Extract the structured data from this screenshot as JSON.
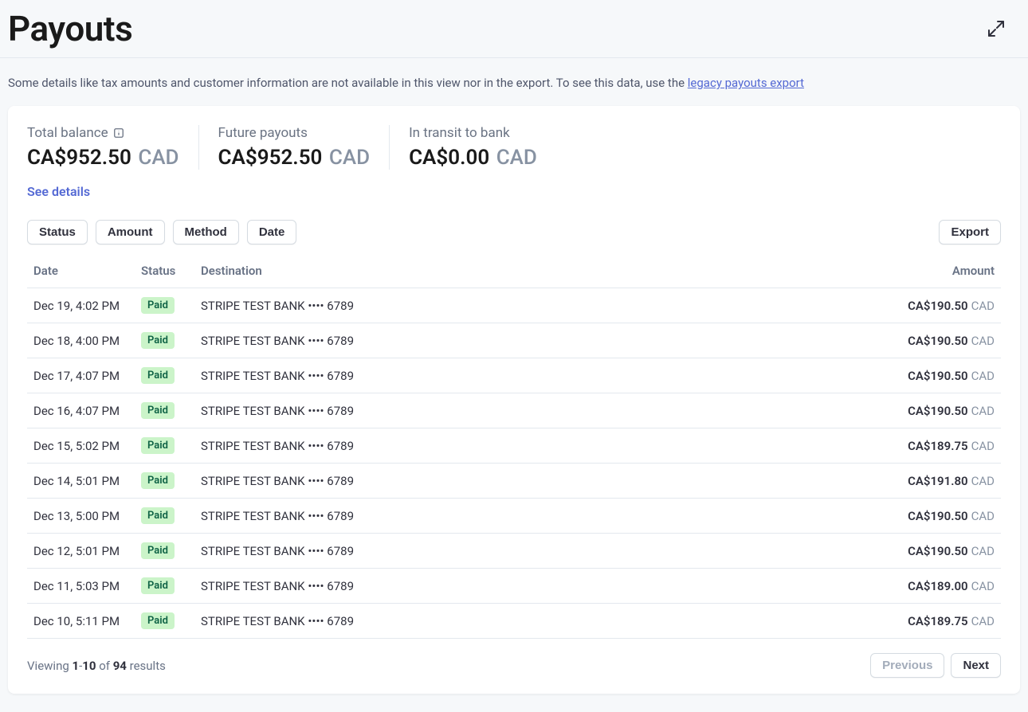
{
  "header": {
    "title": "Payouts"
  },
  "banner": {
    "text": "Some details like tax amounts and customer information are not available in this view nor in the export. To see this data, use the ",
    "link_text": "legacy payouts export"
  },
  "summary": {
    "total_balance": {
      "label": "Total balance",
      "value": "CA$952.50",
      "currency": "CAD"
    },
    "future_payouts": {
      "label": "Future payouts",
      "value": "CA$952.50",
      "currency": "CAD"
    },
    "in_transit": {
      "label": "In transit to bank",
      "value": "CA$0.00",
      "currency": "CAD"
    },
    "see_details": "See details"
  },
  "filters": {
    "status": "Status",
    "amount": "Amount",
    "method": "Method",
    "date": "Date",
    "export": "Export"
  },
  "table": {
    "headers": {
      "date": "Date",
      "status": "Status",
      "destination": "Destination",
      "amount": "Amount"
    },
    "rows": [
      {
        "date": "Dec 19, 4:02 PM",
        "status": "Paid",
        "destination": "STRIPE TEST BANK •••• 6789",
        "amount": "CA$190.50",
        "currency": "CAD"
      },
      {
        "date": "Dec 18, 4:00 PM",
        "status": "Paid",
        "destination": "STRIPE TEST BANK •••• 6789",
        "amount": "CA$190.50",
        "currency": "CAD"
      },
      {
        "date": "Dec 17, 4:07 PM",
        "status": "Paid",
        "destination": "STRIPE TEST BANK •••• 6789",
        "amount": "CA$190.50",
        "currency": "CAD"
      },
      {
        "date": "Dec 16, 4:07 PM",
        "status": "Paid",
        "destination": "STRIPE TEST BANK •••• 6789",
        "amount": "CA$190.50",
        "currency": "CAD"
      },
      {
        "date": "Dec 15, 5:02 PM",
        "status": "Paid",
        "destination": "STRIPE TEST BANK •••• 6789",
        "amount": "CA$189.75",
        "currency": "CAD"
      },
      {
        "date": "Dec 14, 5:01 PM",
        "status": "Paid",
        "destination": "STRIPE TEST BANK •••• 6789",
        "amount": "CA$191.80",
        "currency": "CAD"
      },
      {
        "date": "Dec 13, 5:00 PM",
        "status": "Paid",
        "destination": "STRIPE TEST BANK •••• 6789",
        "amount": "CA$190.50",
        "currency": "CAD"
      },
      {
        "date": "Dec 12, 5:01 PM",
        "status": "Paid",
        "destination": "STRIPE TEST BANK •••• 6789",
        "amount": "CA$190.50",
        "currency": "CAD"
      },
      {
        "date": "Dec 11, 5:03 PM",
        "status": "Paid",
        "destination": "STRIPE TEST BANK •••• 6789",
        "amount": "CA$189.00",
        "currency": "CAD"
      },
      {
        "date": "Dec 10, 5:11 PM",
        "status": "Paid",
        "destination": "STRIPE TEST BANK •••• 6789",
        "amount": "CA$189.75",
        "currency": "CAD"
      }
    ]
  },
  "pagination": {
    "viewing": "Viewing ",
    "from": "1",
    "dash": "-",
    "to": "10",
    "of": " of ",
    "total": "94",
    "results": " results",
    "previous": "Previous",
    "next": "Next"
  }
}
